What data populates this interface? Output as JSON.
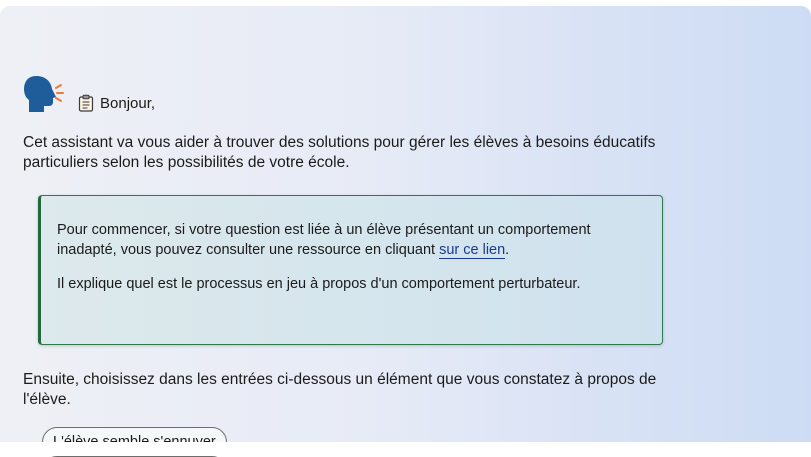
{
  "chat": {
    "greeting": "Bonjour,",
    "intro": "Cet assistant va vous aider à trouver des solutions pour gérer les élèves à besoins éducatifs particuliers selon les possibilités de votre école.",
    "callout": {
      "text_before_link": "Pour commencer, si votre question est liée à un élève présentant un comportement inadapté, vous pouvez consulter une ressource en cliquant ",
      "link_label": "sur ce lien",
      "text_after_link": ".",
      "paragraph2": "Il explique quel est le processus en jeu à propos d'un comportement perturbateur."
    },
    "next_instruction": "Ensuite, choisissez dans les entrées ci-dessous un élément que vous constatez à propos de l'élève.",
    "choices": [
      {
        "label": "L'élève semble s'ennuyer"
      }
    ]
  },
  "icons": {
    "avatar": "speaking-head-icon",
    "greeting_icon": "clipboard-icon"
  },
  "colors": {
    "avatar_blue": "#1f5d9a",
    "avatar_orange": "#f07a2e",
    "callout_border": "#1f6b3d",
    "link": "#1a3a8f"
  }
}
